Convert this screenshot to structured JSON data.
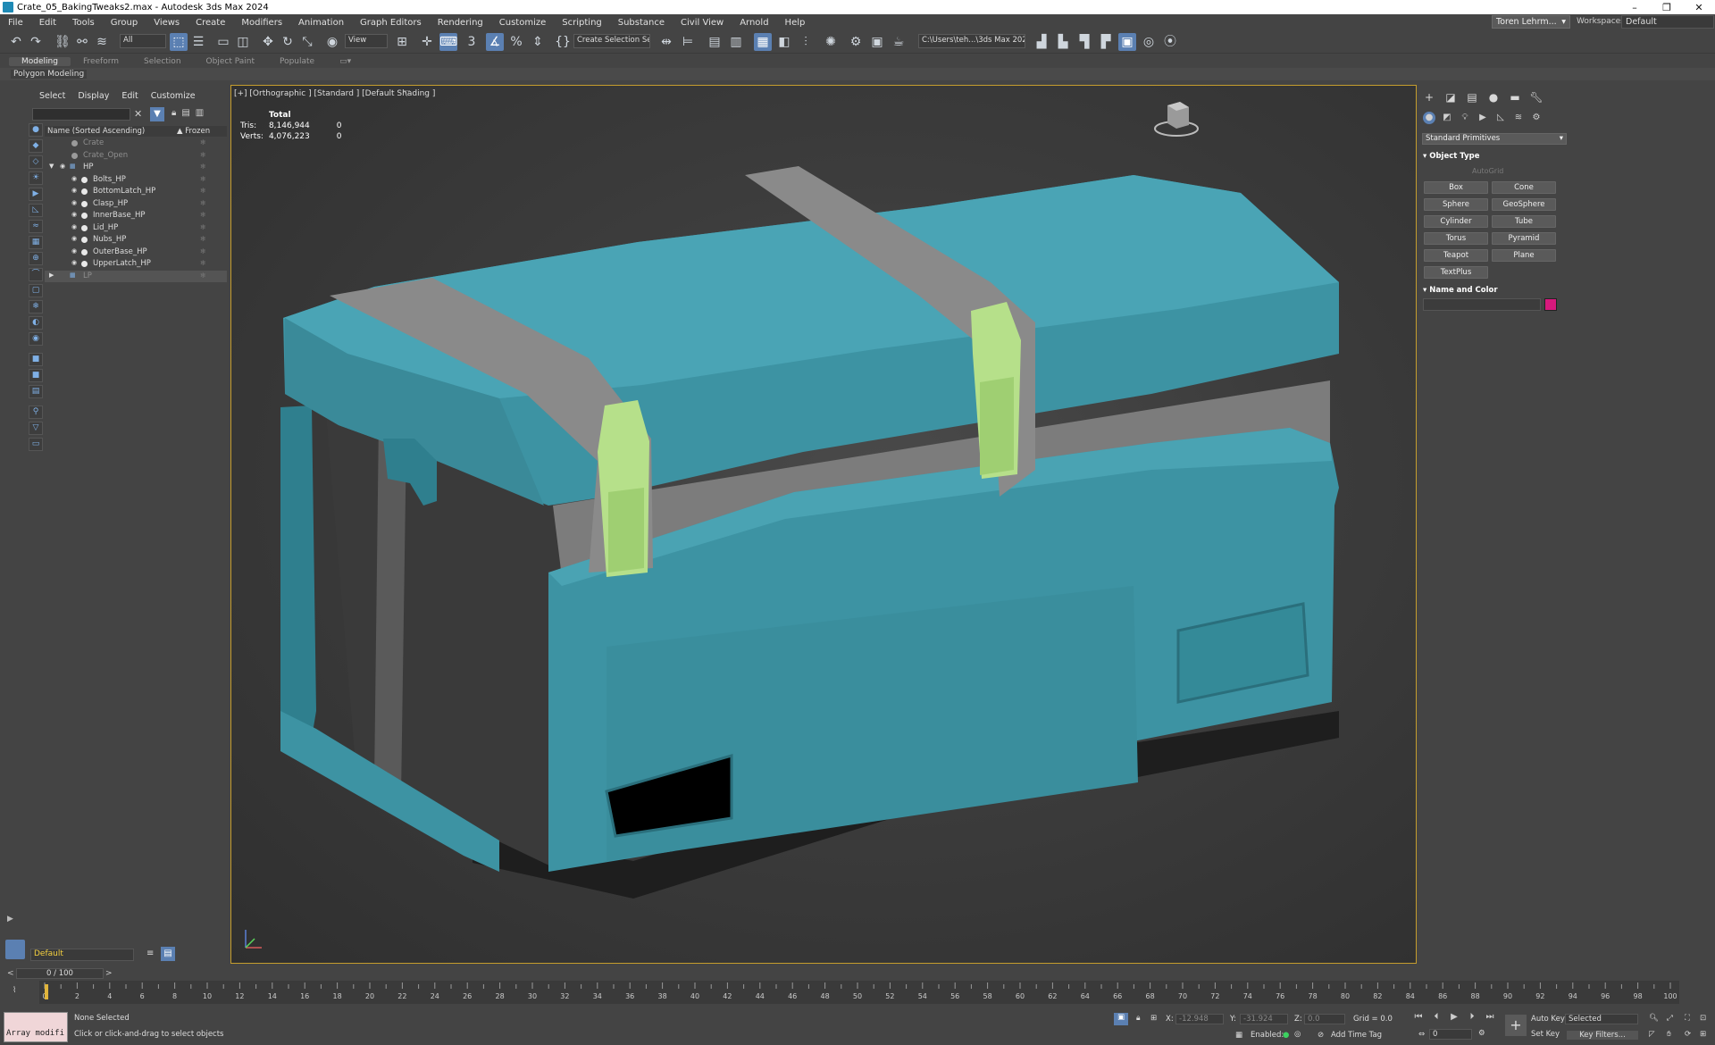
{
  "window": {
    "title": "Crate_05_BakingTweaks2.max - Autodesk 3ds Max 2024",
    "controls": [
      "–",
      "❐",
      "✕"
    ]
  },
  "menubar": [
    "File",
    "Edit",
    "Tools",
    "Group",
    "Views",
    "Create",
    "Modifiers",
    "Animation",
    "Graph Editors",
    "Rendering",
    "Customize",
    "Scripting",
    "Substance",
    "Civil View",
    "Arnold",
    "Help"
  ],
  "user": {
    "name": "Toren Lehrm...",
    "workspaces_label": "Workspaces:",
    "workspace": "Default"
  },
  "toolbar": {
    "selection_filter": "All",
    "reference_coord": "View",
    "named_selection": "Create Selection Se",
    "path": "C:\\Users\\teh...\\3ds Max 2024"
  },
  "ribbon": {
    "tabs": [
      "Modeling",
      "Freeform",
      "Selection",
      "Object Paint",
      "Populate"
    ],
    "active_tab": "Modeling",
    "sub_panel": "Polygon Modeling"
  },
  "scene_explorer": {
    "menu": [
      "Select",
      "Display",
      "Edit",
      "Customize"
    ],
    "header_name": "Name (Sorted Ascending)",
    "header_frozen": "▲ Frozen",
    "rows": [
      {
        "label": "Crate",
        "indent": 0,
        "dim": true
      },
      {
        "label": "Crate_Open",
        "indent": 0,
        "dim": true
      },
      {
        "label": "HP",
        "indent": 0,
        "group": true
      },
      {
        "label": "Bolts_HP",
        "indent": 1
      },
      {
        "label": "BottomLatch_HP",
        "indent": 1
      },
      {
        "label": "Clasp_HP",
        "indent": 1
      },
      {
        "label": "InnerBase_HP",
        "indent": 1
      },
      {
        "label": "Lid_HP",
        "indent": 1
      },
      {
        "label": "Nubs_HP",
        "indent": 1
      },
      {
        "label": "OuterBase_HP",
        "indent": 1
      },
      {
        "label": "UpperLatch_HP",
        "indent": 1
      },
      {
        "label": "LP",
        "indent": 0,
        "group": true,
        "dim": true
      }
    ],
    "layer": "Default"
  },
  "viewport": {
    "label": "[+] [Orthographic ] [Standard ] [Default Shading ]",
    "stats": {
      "header": "Total",
      "tris_label": "Tris:",
      "tris": "8,146,944",
      "tris_sel": "0",
      "verts_label": "Verts:",
      "verts": "4,076,223",
      "verts_sel": "0"
    }
  },
  "command_panel": {
    "dropdown": "Standard Primitives",
    "object_type_title": "Object Type",
    "autogrid": "AutoGrid",
    "buttons": [
      "Box",
      "Cone",
      "Sphere",
      "GeoSphere",
      "Cylinder",
      "Tube",
      "Torus",
      "Pyramid",
      "Teapot",
      "Plane",
      "TextPlus"
    ],
    "name_color_title": "Name and Color",
    "swatch_color": "#d8197d"
  },
  "timeline": {
    "slider": "0 / 100",
    "ticks": [
      "0",
      "2",
      "4",
      "6",
      "8",
      "10",
      "12",
      "14",
      "16",
      "18",
      "20",
      "22",
      "24",
      "26",
      "28",
      "30",
      "32",
      "34",
      "36",
      "38",
      "40",
      "42",
      "44",
      "46",
      "48",
      "50",
      "52",
      "54",
      "56",
      "58",
      "60",
      "62",
      "64",
      "66",
      "68",
      "70",
      "72",
      "74",
      "76",
      "78",
      "80",
      "82",
      "84",
      "86",
      "88",
      "90",
      "92",
      "94",
      "96",
      "98",
      "100"
    ]
  },
  "status": {
    "maxscript": "Array modifi",
    "line1": "None Selected",
    "line2": "Click or click-and-drag to select objects",
    "x_label": "X:",
    "x": "-12.948",
    "y_label": "Y:",
    "y": "-31.924",
    "z_label": "Z:",
    "z": "0.0",
    "grid": "Grid = 0.0",
    "enabled": "Enabled:",
    "add_time_tag": "Add Time Tag",
    "auto_key": "Auto Key",
    "set_key": "Set Key",
    "selected": "Selected",
    "key_filters": "Key Filters...",
    "frame": "0"
  },
  "colors": {
    "crate_teal": "#3d93a3",
    "latch_green": "#b6e08a",
    "strap_gray": "#8a8a8a",
    "accent": "#5b80b2"
  }
}
